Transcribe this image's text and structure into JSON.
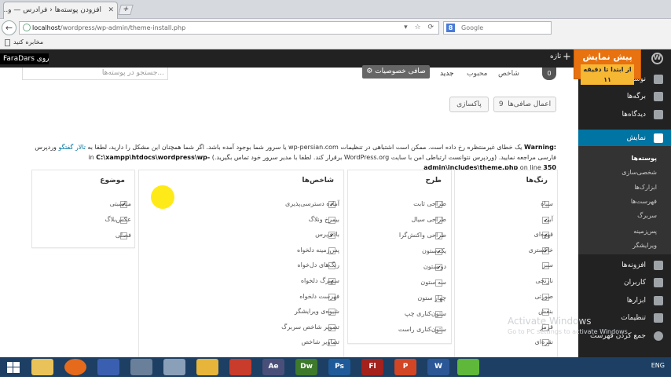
{
  "browser": {
    "tab_title": "افزودن پوسته‌ها ‹ فرادرس — و...",
    "tab_close": "✕",
    "new_tab": "+",
    "url_host": "localhost",
    "url_path": "/wordpress/wp-admin/theme-install.php",
    "search_engine": "Google",
    "search_placeholder": "Google",
    "bookmark_label": "مخابره کنید",
    "back": "←"
  },
  "admin_bar": {
    "new_label": "تازه",
    "new_plus": "+",
    "site_ticker": "FaraDars دروی،",
    "banner_title": "پیش نمایش",
    "banner_subtitle": "از ابتدا تا دقیقه ۱۱"
  },
  "sidebar": {
    "items": [
      {
        "label": "نوشته‌ها",
        "icon": "pin-icon"
      },
      {
        "label": "برگه‌ها",
        "icon": "pages-icon"
      },
      {
        "label": "دیدگاه‌ها",
        "icon": "comments-icon"
      },
      {
        "label": "نمایش",
        "icon": "appearance-icon"
      },
      {
        "label": "افزونه‌ها",
        "icon": "plugins-icon"
      },
      {
        "label": "کاربران",
        "icon": "users-icon"
      },
      {
        "label": "ابزارها",
        "icon": "tools-icon"
      },
      {
        "label": "تنظیمات",
        "icon": "settings-icon"
      },
      {
        "label": "جمع کردن فهرست",
        "icon": "collapse-icon"
      }
    ],
    "submenu": [
      "پوسته‌ها",
      "شخصی‌سازی",
      "ابزارک‌ها",
      "فهرست‌ها",
      "سربرگ",
      "پس‌زمینه",
      "ویرایشگر"
    ]
  },
  "filters": {
    "count": "0",
    "tabs": [
      "شاخص",
      "محبوب",
      "جدید"
    ],
    "feature_filter": "صافی خصوصیات",
    "search_placeholder": "جستجو در پوسته‌ها...",
    "apply_filters": "اعمال صافی‌ها",
    "apply_count": "9",
    "clear": "پاکسازی"
  },
  "warning": {
    "label": "Warning:",
    "text": "یک خطای غیرمنتظره رخ داده است. ممکن است اشتباهی در تنظیمات wp-persian.com یا سرور شما بوجود آمده باشد. اگر شما همچنان این مشکل را دارید، لطفا به",
    "link": "تالار گفتگو",
    "text2": "وردپرس فارسی مراجعه نمایید. (وردپرس نتوانست ارتباطی امن با سایت WordPress.org برقرار کند. لطفا با مدیر سرور خود تماس بگیرید.) in",
    "path": "C:\\xampp\\htdocs\\wordpress\\wp-admin\\includes\\theme.php",
    "line_label": "on line",
    "line": "350"
  },
  "panels": {
    "colors": {
      "title": "رنگ‌ها",
      "options": [
        {
          "label": "سیاه",
          "checked": false
        },
        {
          "label": "آبی",
          "checked": true
        },
        {
          "label": "قهوه‌ای",
          "checked": true
        },
        {
          "label": "خاکستری",
          "checked": true
        },
        {
          "label": "سبز",
          "checked": false
        },
        {
          "label": "نارنجی",
          "checked": false
        },
        {
          "label": "صورتی",
          "checked": false
        },
        {
          "label": "بنفش",
          "checked": false
        },
        {
          "label": "قرمز",
          "checked": false
        },
        {
          "label": "نقره‌ای",
          "checked": false
        }
      ]
    },
    "layout": {
      "title": "طرح",
      "options": [
        {
          "label": "طراحی ثابت",
          "checked": false
        },
        {
          "label": "طراحی سیال",
          "checked": false
        },
        {
          "label": "طراحی واکنش‌گرا",
          "checked": false
        },
        {
          "label": "یک ستون",
          "checked": true
        },
        {
          "label": "دو ستون",
          "checked": true
        },
        {
          "label": "سه ستون",
          "checked": false
        },
        {
          "label": "چهار ستون",
          "checked": false
        },
        {
          "label": "ستون‌کناری چپ",
          "checked": false
        },
        {
          "label": "ستون‌کناری راست",
          "checked": false
        }
      ]
    },
    "features": {
      "title": "شاخص‌ها",
      "options": [
        {
          "label": "آماده دسترسی‌پذیری",
          "checked": true
        },
        {
          "label": "بیمرخ ونلاگ",
          "checked": false
        },
        {
          "label": "بادی‌پرس",
          "checked": true
        },
        {
          "label": "پس‌زمینه دلخواه",
          "checked": false
        },
        {
          "label": "رنگ‌های دل‌خواه",
          "checked": false
        },
        {
          "label": "سربرگ دلخواه",
          "checked": true
        },
        {
          "label": "فهرست دلخواه",
          "checked": false
        },
        {
          "label": "شیوه‌ی ویرایشگر",
          "checked": false
        },
        {
          "label": "تصویر شاخص سربرگ",
          "checked": false
        },
        {
          "label": "تصاویر شاخص",
          "checked": false
        }
      ]
    },
    "subject": {
      "title": "موضوع",
      "options": [
        {
          "label": "مناسبتی",
          "checked": true
        },
        {
          "label": "عکس‌بلاگ",
          "checked": false
        },
        {
          "label": "فصلی",
          "checked": false
        }
      ]
    }
  },
  "windows": {
    "activate_title": "Activate Windows",
    "activate_sub": "Go to PC settings to activate Windows."
  },
  "taskbar": {
    "apps": [
      "start",
      "explorer",
      "firefox",
      "media",
      "tools",
      "files",
      "camtasia",
      "presenter",
      "Ae",
      "Dw",
      "Ps",
      "Fl",
      "P",
      "W",
      "wallet"
    ],
    "lang": "ENG"
  },
  "colors": {
    "admin_bar": "#222222",
    "sidebar_active": "#0074a2",
    "banner": "#e7720f"
  }
}
